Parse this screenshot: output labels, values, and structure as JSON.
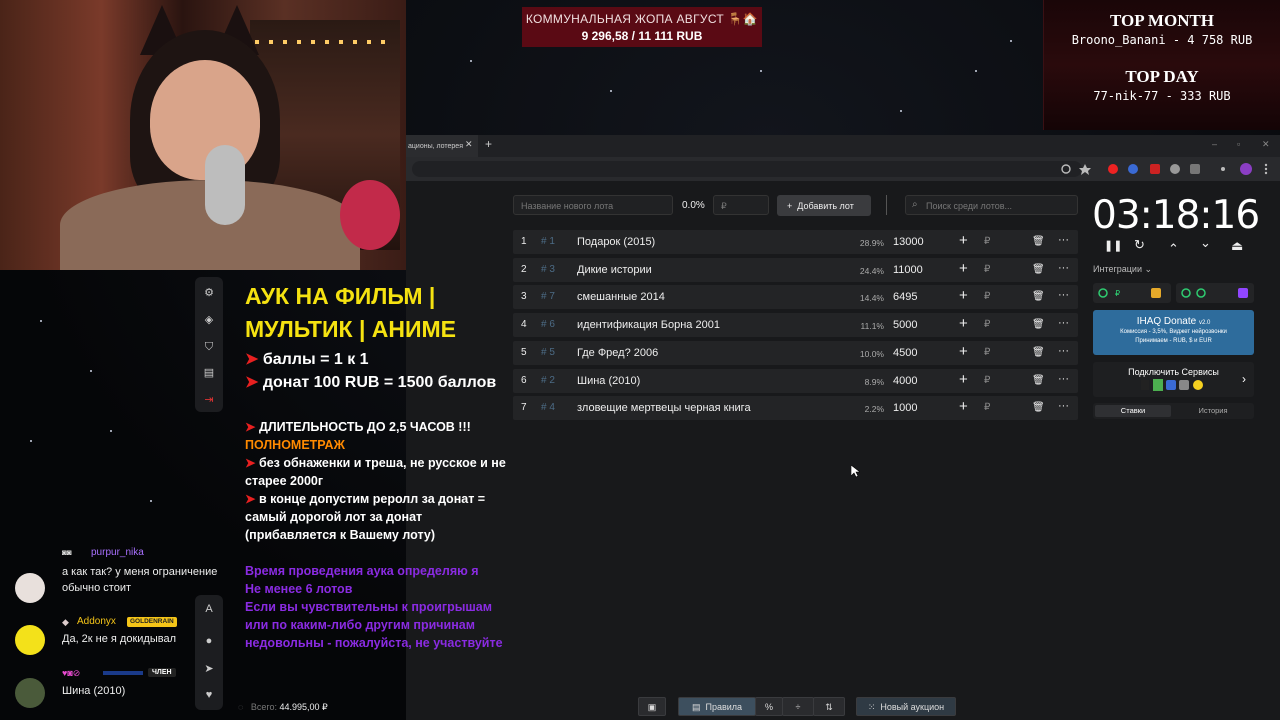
{
  "overlay": {
    "goal_title": "КОММУНАЛЬНАЯ ЖОПА АВГУСТ 🪑🏠",
    "goal_value": "9 296,58 / 11 111 RUB",
    "top_month_label": "TOP MONTH",
    "top_month_value": "Broono_Banani - 4 758 RUB",
    "top_day_label": "TOP DAY",
    "top_day_value": "77-nik-77 - 333 RUB"
  },
  "browser": {
    "tab_title": "ационы, лотерея",
    "tab_close": "✕",
    "new_tab": "+",
    "window_controls": [
      "–",
      "▫",
      "✕"
    ]
  },
  "rules": {
    "title_line1": "АУК НА ФИЛЬМ  |",
    "title_line2": "МУЛЬТИК | АНИМЕ",
    "points_eq": "баллы = 1 к 1",
    "donate_rate": "донат 100 RUB = 1500 баллов",
    "duration": "ДЛИТЕЛЬНОСТЬ ДО 2,5 ЧАСОВ !!!",
    "full_length": "ПОЛНОМЕТРАЖ",
    "restriction": "без обнаженки и треша, не русское и не старее 2000г",
    "reroll": "в конце допустим реролл за донат = самый дорогой лот за донат (прибавляется к Вашему лоту)",
    "p1": "Время проведения аука определяю я",
    "p2": "Не менее 6 лотов",
    "p3": "Если вы чувствительны к проигрышам или по каким-либо другим причинам недовольны - пожалуйста, не участвуйте"
  },
  "auction": {
    "new_lot_placeholder": "Название нового лота",
    "percent": "0.0%",
    "amount_placeholder": "₽",
    "add_lot_label": "Добавить лот",
    "search_placeholder": "Поиск среди лотов...",
    "lots": [
      {
        "num": "1",
        "id": "# 1",
        "name": "Подарок (2015)",
        "pct": "28.9%",
        "amount": "13000"
      },
      {
        "num": "2",
        "id": "# 3",
        "name": "Дикие истории",
        "pct": "24.4%",
        "amount": "11000"
      },
      {
        "num": "3",
        "id": "# 7",
        "name": "смешанные 2014",
        "pct": "14.4%",
        "amount": "6495"
      },
      {
        "num": "4",
        "id": "# 6",
        "name": "идентификация Борна 2001",
        "pct": "11.1%",
        "amount": "5000"
      },
      {
        "num": "5",
        "id": "# 5",
        "name": "Где Фред? 2006",
        "pct": "10.0%",
        "amount": "4500"
      },
      {
        "num": "6",
        "id": "# 2",
        "name": "Шина (2010)",
        "pct": "8.9%",
        "amount": "4000"
      },
      {
        "num": "7",
        "id": "# 4",
        "name": "зловещие мертвецы черная книга",
        "pct": "2.2%",
        "amount": "1000"
      }
    ],
    "lot_plus": "+",
    "lot_currency": "₽",
    "lot_more": "···",
    "total_label": "Всего:",
    "total_value": "44.995,00 ₽"
  },
  "timer": {
    "value": "03:18:16",
    "controls": [
      "❚❚",
      "↻",
      "⌃",
      "⌄",
      "⏏"
    ]
  },
  "right": {
    "integrations_label": "Интеграции",
    "ihaq_title": "IHAQ Donate",
    "ihaq_version": "v2.0",
    "ihaq_commission": "Комиссия - 3,5%, Виджет нейрозвонки",
    "ihaq_accept": "Принимаем - RUB, $ и EUR",
    "connect_label": "Подключить Сервисы",
    "tab_bets": "Ставки",
    "tab_history": "История"
  },
  "chat": {
    "messages": [
      {
        "user": "purpur_nika",
        "text": "а как так? у меня ограничение обычно стоит"
      },
      {
        "user": "Addonyx",
        "badge": "GOLDENRAIN",
        "text": "Да, 2к не я докидывал"
      },
      {
        "user": "",
        "badge": "ЧЛЕН",
        "text": "Шина (2010)"
      }
    ]
  },
  "bottom_bar": {
    "rules_label": "Правила",
    "percent_icon": "%",
    "new_auction_label": "Новый аукцион"
  },
  "colors": {
    "rules_title": "#f5e211",
    "arrow": "#e82020",
    "orange": "#ff8a00",
    "purple": "#8a2be2",
    "ihaq": "#2e6c9c"
  }
}
